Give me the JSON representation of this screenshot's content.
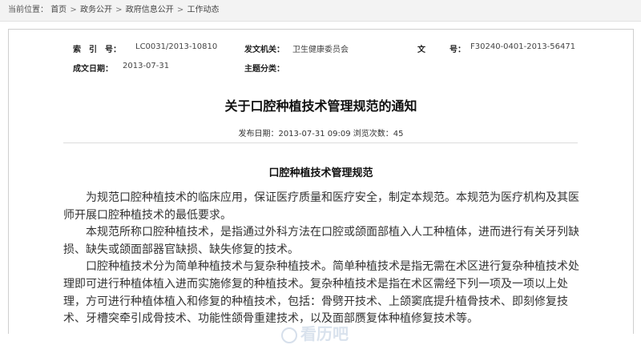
{
  "breadcrumb": {
    "prefix": "当前位置：",
    "items": [
      "首页",
      "政务公开",
      "政府信息公开",
      "工作动态"
    ],
    "separator": ">"
  },
  "meta": {
    "index_label": "索　引　号：",
    "index_value": "LC0031/2013-10810",
    "issuer_label": "发文机关：",
    "issuer_value": "卫生健康委员会",
    "docno_label": "文　　　号：",
    "docno_value": "F30240-0401-2013-56471",
    "date_label": "成文日期：",
    "date_value": "2013-07-31",
    "topic_label": "主题分类：",
    "topic_value": ""
  },
  "article": {
    "title": "关于口腔种植技术管理规范的通知",
    "publish_label": "发布日期：",
    "publish_time": "2013-07-31 09:09",
    "views_label": "浏览次数：",
    "views": "45",
    "subtitle": "口腔种植技术管理规范",
    "paragraphs": [
      "为规范口腔种植技术的临床应用，保证医疗质量和医疗安全，制定本规范。本规范为医疗机构及其医师开展口腔种植技术的最低要求。",
      "本规范所称口腔种植技术，是指通过外科方法在口腔或颌面部植入人工种植体，进而进行有关牙列缺损、缺失或颌面部器官缺损、缺失修复的技术。",
      "口腔种植技术分为简单种植技术与复杂种植技术。简单种植技术是指无需在术区进行复杂种植技术处理即可进行种植体植入进而实施修复的种植技术。复杂种植技术是指在术区需经下列一项及一项以上处理，方可进行种植体植入和修复的种植技术，包括：骨劈开技术、上颌窦底提升植骨技术、即刻修复技术、牙槽突牵引成骨技术、功能性颌骨重建技术，以及面部赝复体种植修复技术等。"
    ]
  },
  "watermark": {
    "text": "看历吧"
  }
}
